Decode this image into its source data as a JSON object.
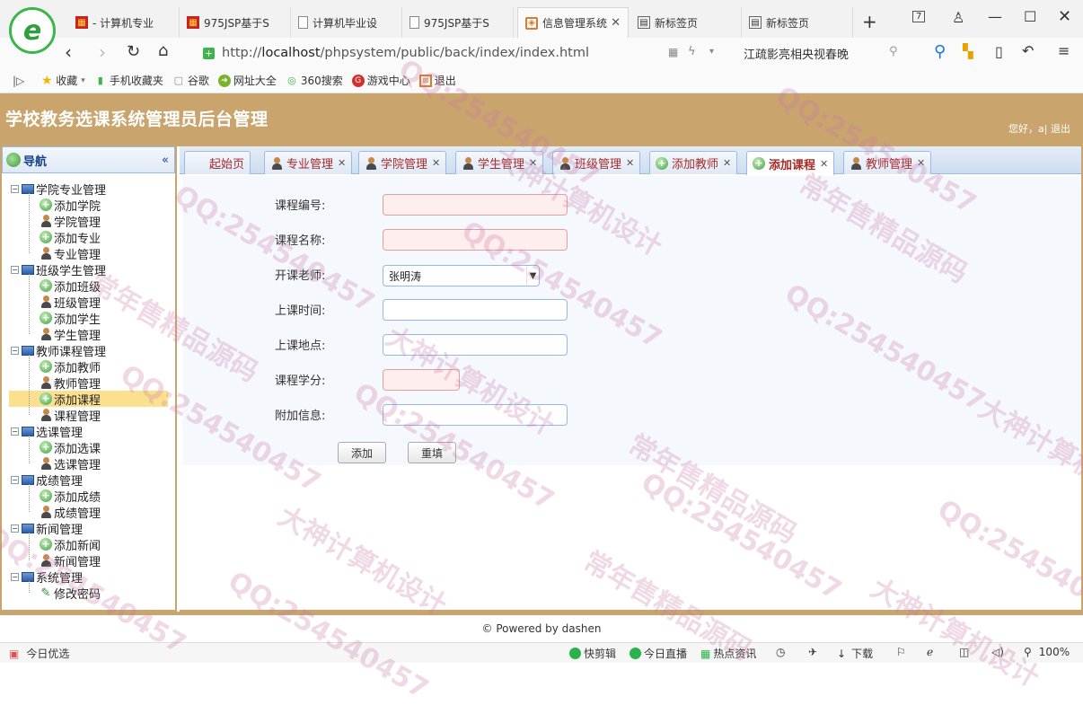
{
  "browser": {
    "tabs": [
      {
        "title": "- 计算机专业",
        "favicon": "red"
      },
      {
        "title": "975JSP基于S",
        "favicon": "red"
      },
      {
        "title": "计算机毕业设",
        "favicon": "doc"
      },
      {
        "title": "975JSP基于S",
        "favicon": "doc"
      },
      {
        "title": "信息管理系统",
        "favicon": "orange",
        "active": true
      },
      {
        "title": "新标签页",
        "favicon": "grid"
      },
      {
        "title": "新标签页",
        "favicon": "grid"
      }
    ],
    "tab_count": "7",
    "url_prefix": "http://",
    "url_host": "localhost",
    "url_path": "/phpsystem/public/back/index/index.html",
    "search_hint": "江疏影亮相央视春晚",
    "bookmarks": [
      "收藏",
      "手机收藏夹",
      "谷歌",
      "网址大全",
      "360搜索",
      "游戏中心",
      "退出"
    ]
  },
  "app": {
    "title": "学校教务选课系统管理员后台管理",
    "welcome": "您好，a| 退出"
  },
  "nav": {
    "title": "导航",
    "groups": [
      {
        "label": "学院专业管理",
        "items": [
          {
            "label": "添加学院",
            "icon": "add"
          },
          {
            "label": "学院管理",
            "icon": "user"
          },
          {
            "label": "添加专业",
            "icon": "add"
          },
          {
            "label": "专业管理",
            "icon": "user"
          }
        ]
      },
      {
        "label": "班级学生管理",
        "items": [
          {
            "label": "添加班级",
            "icon": "add"
          },
          {
            "label": "班级管理",
            "icon": "user"
          },
          {
            "label": "添加学生",
            "icon": "add"
          },
          {
            "label": "学生管理",
            "icon": "user"
          }
        ]
      },
      {
        "label": "教师课程管理",
        "items": [
          {
            "label": "添加教师",
            "icon": "add"
          },
          {
            "label": "教师管理",
            "icon": "user"
          },
          {
            "label": "添加课程",
            "icon": "add",
            "selected": true
          },
          {
            "label": "课程管理",
            "icon": "user"
          }
        ]
      },
      {
        "label": "选课管理",
        "items": [
          {
            "label": "添加选课",
            "icon": "add"
          },
          {
            "label": "选课管理",
            "icon": "user"
          }
        ]
      },
      {
        "label": "成绩管理",
        "items": [
          {
            "label": "添加成绩",
            "icon": "add"
          },
          {
            "label": "成绩管理",
            "icon": "user"
          }
        ]
      },
      {
        "label": "新闻管理",
        "items": [
          {
            "label": "添加新闻",
            "icon": "add"
          },
          {
            "label": "新闻管理",
            "icon": "user"
          }
        ]
      },
      {
        "label": "系统管理",
        "items": [
          {
            "label": "修改密码",
            "icon": "pen"
          }
        ]
      }
    ]
  },
  "panel_tabs": [
    {
      "label": "起始页",
      "icon": "none",
      "closable": false
    },
    {
      "label": "专业管理",
      "icon": "user",
      "closable": true
    },
    {
      "label": "学院管理",
      "icon": "user",
      "closable": true
    },
    {
      "label": "学生管理",
      "icon": "user",
      "closable": true
    },
    {
      "label": "班级管理",
      "icon": "user",
      "closable": true
    },
    {
      "label": "添加教师",
      "icon": "add",
      "closable": true
    },
    {
      "label": "添加课程",
      "icon": "add",
      "closable": true,
      "active": true
    },
    {
      "label": "教师管理",
      "icon": "user",
      "closable": true
    }
  ],
  "form": {
    "course_no_label": "课程编号:",
    "course_name_label": "课程名称:",
    "teacher_label": "开课老师:",
    "teacher_value": "张明涛",
    "time_label": "上课时间:",
    "place_label": "上课地点:",
    "credit_label": "课程学分:",
    "extra_label": "附加信息:",
    "submit_label": "添加",
    "reset_label": "重填"
  },
  "footer": {
    "powered": "© Powered by dashen"
  },
  "statusbar": {
    "left": "今日优选",
    "items": [
      "快剪辑",
      "今日直播",
      "热点资讯"
    ],
    "download": "下载",
    "zoom": "100%"
  },
  "watermarks": [
    "QQ:254540457",
    "大神计算机设计",
    "常年售精品源码"
  ]
}
